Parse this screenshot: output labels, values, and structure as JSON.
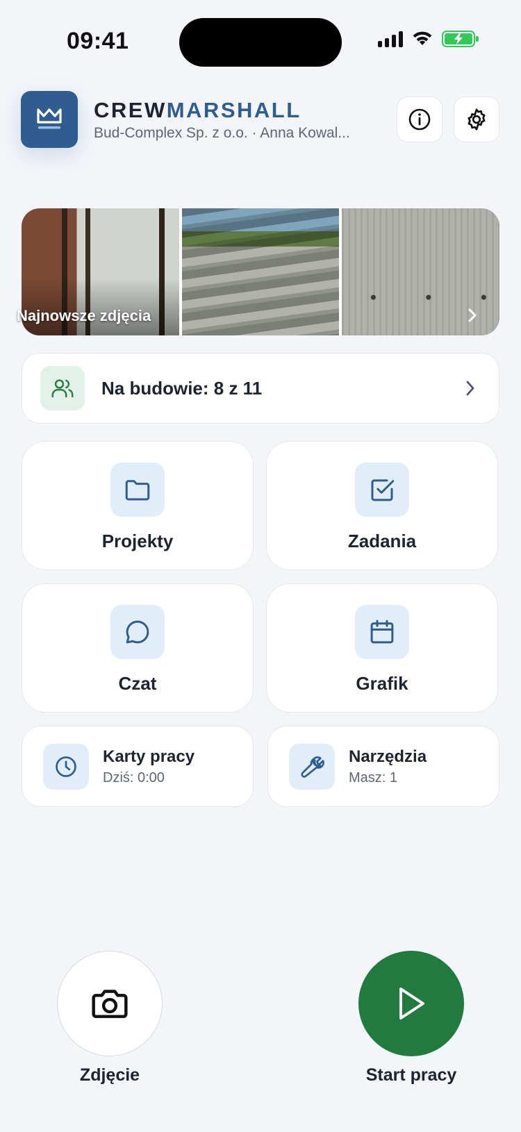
{
  "status_bar": {
    "time": "09:41"
  },
  "header": {
    "brand_part1": "CREW",
    "brand_part2": "MARSHALL",
    "subtitle": "Bud-Complex Sp. z o.o. · Anna Kowal..."
  },
  "photos": {
    "label": "Najnowsze zdjęcia"
  },
  "crew": {
    "text": "Na budowie: 8 z 11"
  },
  "tiles": [
    {
      "label": "Projekty",
      "icon": "folder-icon"
    },
    {
      "label": "Zadania",
      "icon": "checkbox-icon"
    },
    {
      "label": "Czat",
      "icon": "chat-bubble-icon"
    },
    {
      "label": "Grafik",
      "icon": "calendar-icon"
    }
  ],
  "cards": [
    {
      "title": "Karty pracy",
      "subtitle": "Dziś: 0:00",
      "icon": "clock-icon"
    },
    {
      "title": "Narzędzia",
      "subtitle": "Masz: 1",
      "icon": "wrench-icon"
    }
  ],
  "actions": {
    "photo_label": "Zdjęcie",
    "start_label": "Start pracy"
  },
  "colors": {
    "brand_blue": "#2f5d8f",
    "start_green": "#217a3e",
    "background": "#f3f5f9"
  }
}
